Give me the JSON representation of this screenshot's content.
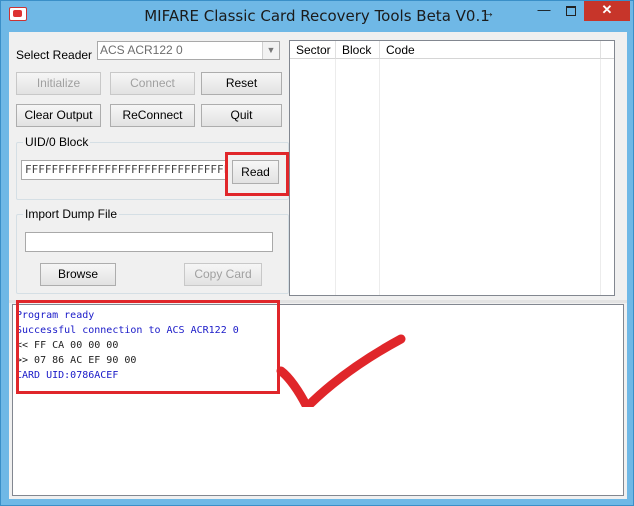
{
  "window": {
    "title": "MIFARE Classic Card Recovery Tools Beta V0.1",
    "resize_glyph": "↔",
    "min_label": "—",
    "close_label": "✕"
  },
  "reader": {
    "label": "Select Reader",
    "selected": "ACS ACR122 0"
  },
  "buttons": {
    "initialize": "Initialize",
    "connect": "Connect",
    "reset": "Reset",
    "clear_output": "Clear Output",
    "reconnect": "ReConnect",
    "quit": "Quit",
    "read": "Read",
    "browse": "Browse",
    "copy_card": "Copy Card"
  },
  "uid": {
    "group_title": "UID/0 Block",
    "value": "FFFFFFFFFFFFFFFFFFFFFFFFFFFFFFFF"
  },
  "dump": {
    "group_title": "Import Dump File",
    "path": ""
  },
  "table": {
    "columns": [
      "Sector",
      "Block",
      "Code"
    ]
  },
  "output": {
    "lines": [
      {
        "text": "Program ready",
        "color": "blue"
      },
      {
        "text": "Successful connection to ACS ACR122 0",
        "color": "blue"
      },
      {
        "text": "<< FF CA 00 00 00",
        "color": "black"
      },
      {
        "text": ">> 07 86 AC EF 90 00",
        "color": "black"
      },
      {
        "text": "CARD UID:0786ACEF",
        "color": "blue"
      }
    ]
  },
  "colors": {
    "annotation_red": "#e0262a",
    "titlebar_blue": "#6fb8e6",
    "close_red": "#c7352a",
    "output_blue": "#1a1ac8"
  }
}
